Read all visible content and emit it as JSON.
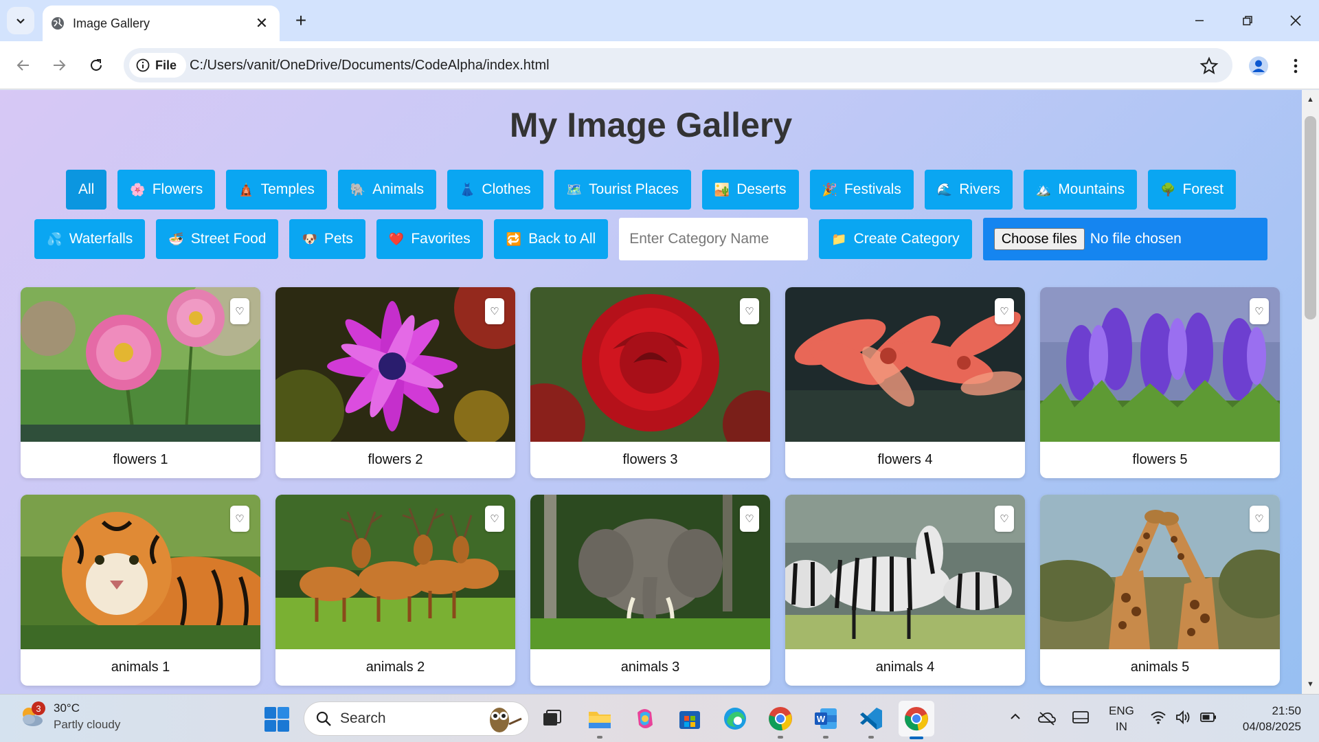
{
  "browser": {
    "tab_title": "Image Gallery",
    "site_chip": "File",
    "url": "C:/Users/vanit/OneDrive/Documents/CodeAlpha/index.html"
  },
  "page": {
    "title": "My Image Gallery",
    "row1": [
      {
        "label": "All",
        "emoji": ""
      },
      {
        "label": "Flowers",
        "emoji": "🌸"
      },
      {
        "label": "Temples",
        "emoji": "🛕"
      },
      {
        "label": "Animals",
        "emoji": "🐘"
      },
      {
        "label": "Clothes",
        "emoji": "👗"
      },
      {
        "label": "Tourist Places",
        "emoji": "🗺️"
      },
      {
        "label": "Deserts",
        "emoji": "🏜️"
      },
      {
        "label": "Festivals",
        "emoji": "🎉"
      },
      {
        "label": "Rivers",
        "emoji": "🌊"
      },
      {
        "label": "Mountains",
        "emoji": "🏔️"
      },
      {
        "label": "Forest",
        "emoji": "🌳"
      }
    ],
    "row2": [
      {
        "label": "Waterfalls",
        "emoji": "💦"
      },
      {
        "label": "Street Food",
        "emoji": "🍜"
      },
      {
        "label": "Pets",
        "emoji": "🐶"
      },
      {
        "label": "Favorites",
        "emoji": "❤️"
      },
      {
        "label": "Back to All",
        "emoji": "🔁"
      }
    ],
    "category_input_placeholder": "Enter Category Name",
    "create_category": {
      "label": "Create Category",
      "emoji": "📁"
    },
    "file_input": {
      "button": "Choose files",
      "status": "No file chosen"
    },
    "fav_glyph": "♡",
    "cards": [
      {
        "caption": "flowers 1",
        "art": "flower-pink"
      },
      {
        "caption": "flowers 2",
        "art": "flower-magenta"
      },
      {
        "caption": "flowers 3",
        "art": "rose-red"
      },
      {
        "caption": "flowers 4",
        "art": "lily-coral"
      },
      {
        "caption": "flowers 5",
        "art": "crocus-purple"
      },
      {
        "caption": "animals 1",
        "art": "tiger"
      },
      {
        "caption": "animals 2",
        "art": "deer"
      },
      {
        "caption": "animals 3",
        "art": "elephant"
      },
      {
        "caption": "animals 4",
        "art": "zebra"
      },
      {
        "caption": "animals 5",
        "art": "giraffe"
      }
    ]
  },
  "taskbar": {
    "weather_badge": "3",
    "temperature": "30°C",
    "condition": "Partly cloudy",
    "search_label": "Search",
    "lang_top": "ENG",
    "lang_bottom": "IN",
    "time": "21:50",
    "date": "04/08/2025"
  },
  "colors": {
    "button_blue": "#0aa6f2",
    "file_blue": "#1585f0",
    "page_gradient_start": "#d7c8f5",
    "page_gradient_end": "#97bff2"
  }
}
